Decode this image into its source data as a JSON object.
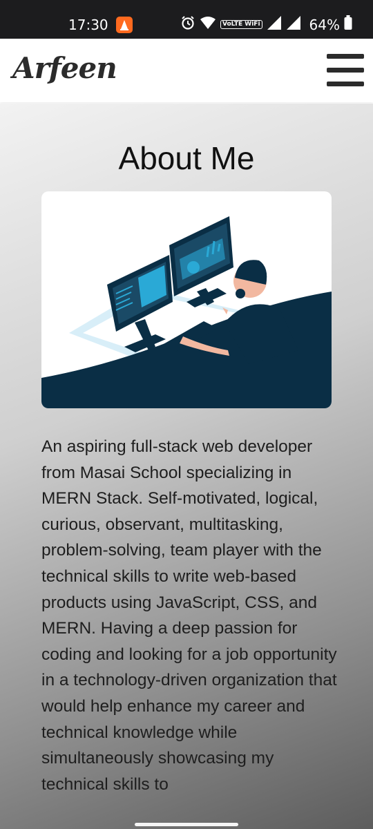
{
  "status_bar": {
    "time": "17:30",
    "network_label": "VoLTE WiFi",
    "battery": "64%",
    "icons": [
      "alarm-icon",
      "wifi-icon",
      "signal-icon",
      "battery-icon"
    ]
  },
  "header": {
    "logo": "Arfeen",
    "menu_icon": "hamburger-icon"
  },
  "main": {
    "title": "About Me",
    "image_description": "developer-illustration",
    "bio": "An aspiring full-stack web developer from Masai School specializing in MERN Stack. Self-motivated, logical, curious, observant, multitasking, problem-solving, team player with the technical skills to write web-based products using JavaScript, CSS, and MERN. Having a deep passion for coding and looking for a job opportunity in a technology-driven organization that would help enhance my career and technical knowledge while simultaneously showcasing my technical skills to"
  },
  "colors": {
    "status_bar_bg": "#1c1c1e",
    "notification_icon": "#ff6a1f",
    "illustration_dark": "#0a2e45",
    "illustration_accent": "#2aa9d6"
  }
}
